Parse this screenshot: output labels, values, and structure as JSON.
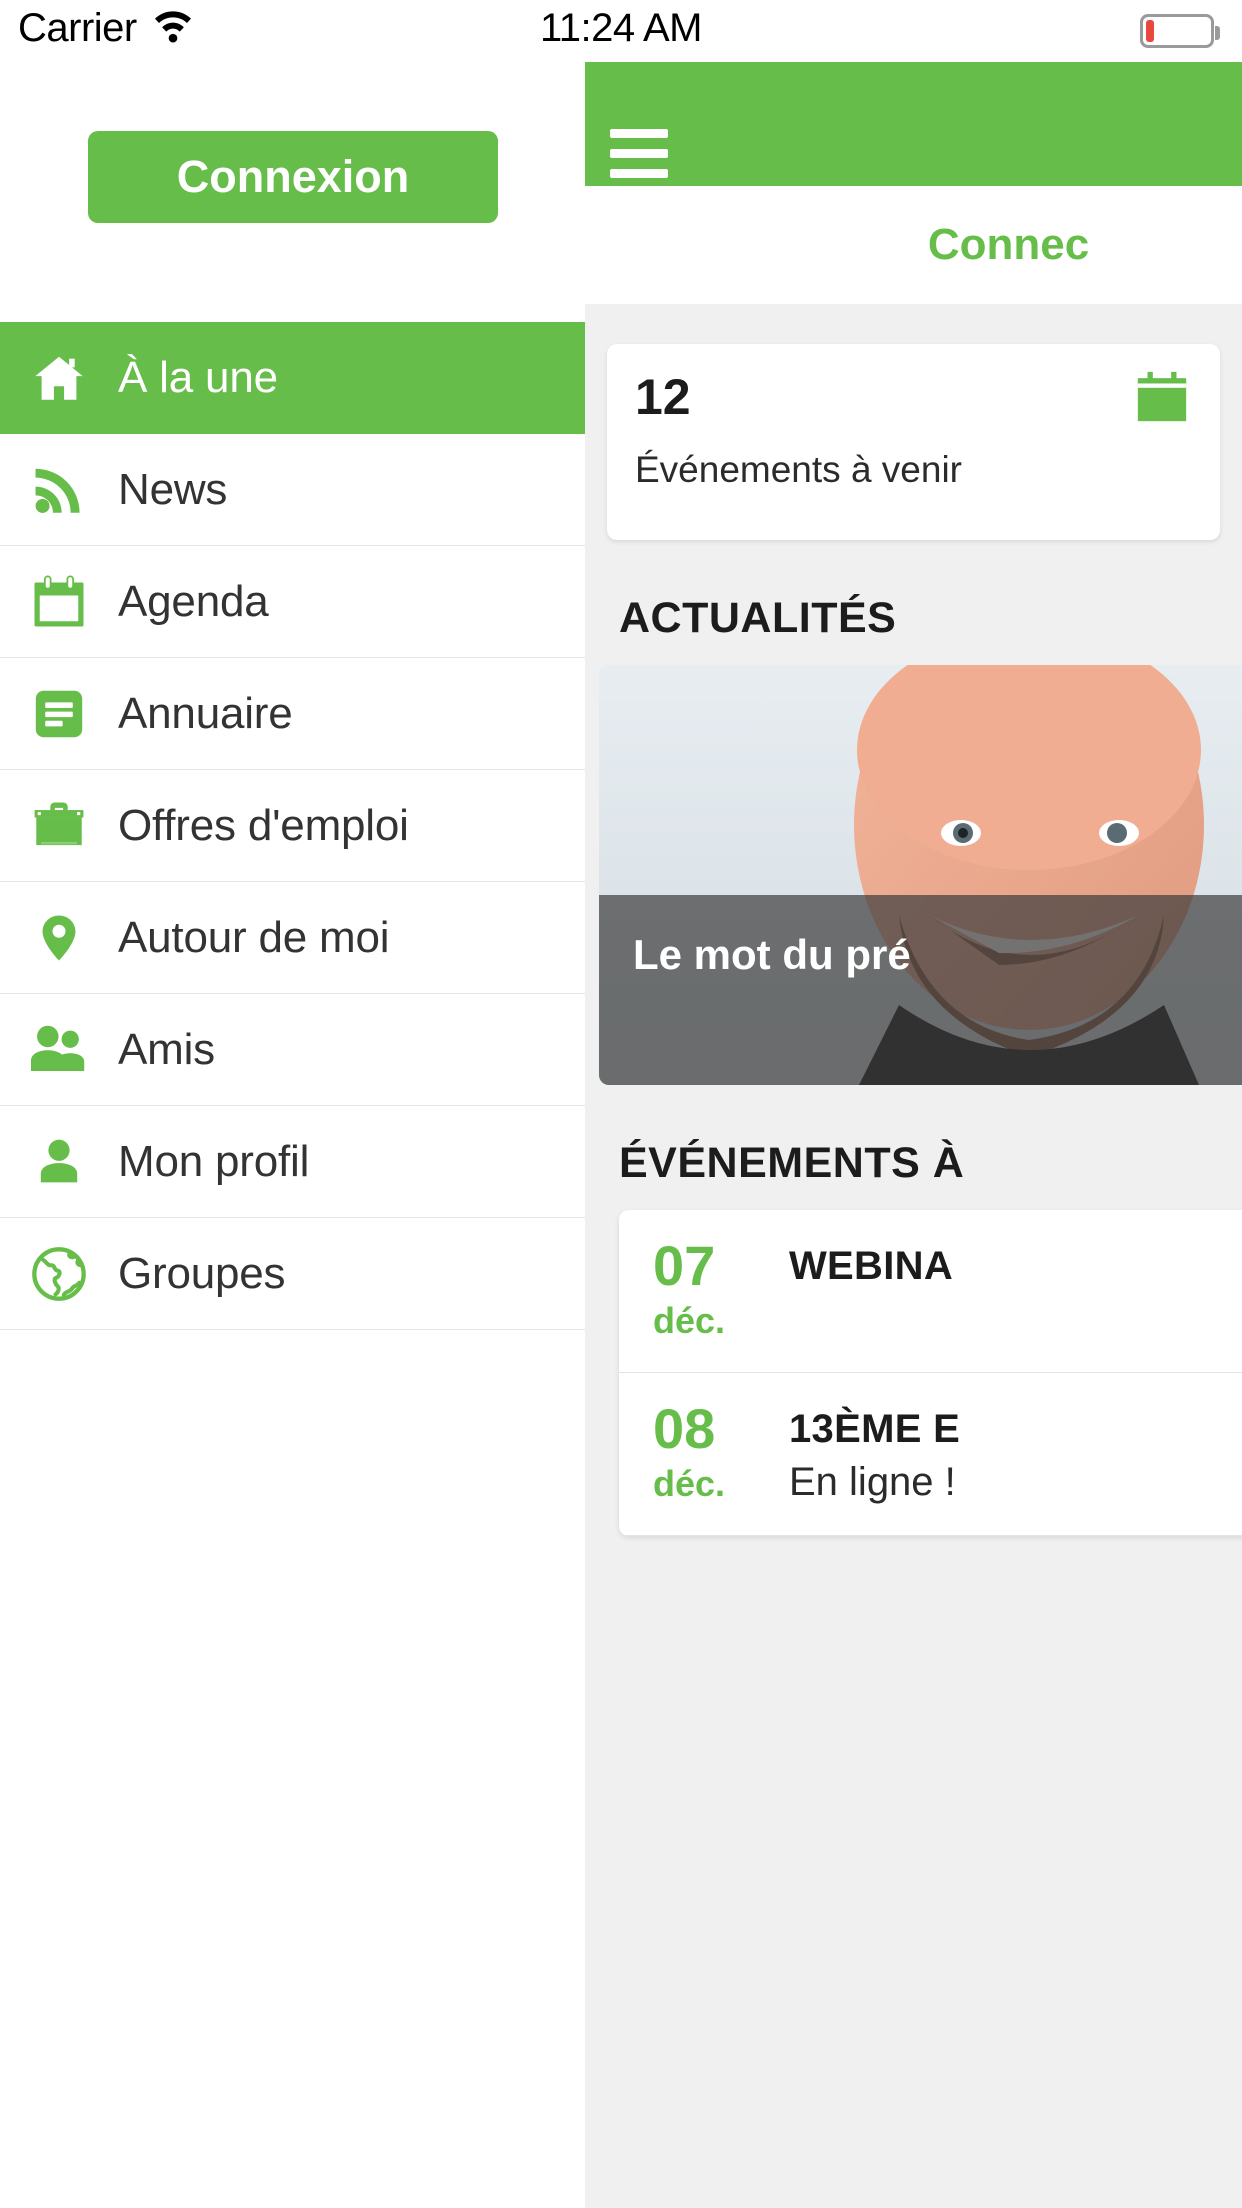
{
  "statusbar": {
    "carrier": "Carrier",
    "time": "11:24 AM",
    "wifi_icon": "wifi-icon",
    "battery_icon": "battery-low-icon"
  },
  "drawer": {
    "login_button_label": "Connexion",
    "menu_items": [
      {
        "label": "À la une",
        "icon": "home-icon",
        "active": true
      },
      {
        "label": "News",
        "icon": "rss-icon",
        "active": false
      },
      {
        "label": "Agenda",
        "icon": "calendar-icon",
        "active": false
      },
      {
        "label": "Annuaire",
        "icon": "directory-icon",
        "active": false
      },
      {
        "label": "Offres d'emploi",
        "icon": "briefcase-icon",
        "active": false
      },
      {
        "label": "Autour de moi",
        "icon": "map-pin-icon",
        "active": false
      },
      {
        "label": "Amis",
        "icon": "people-icon",
        "active": false
      },
      {
        "label": "Mon profil",
        "icon": "person-icon",
        "active": false
      },
      {
        "label": "Groupes",
        "icon": "globe-icon",
        "active": false
      }
    ]
  },
  "content": {
    "header": {
      "menu_icon": "hamburger-icon"
    },
    "login_link_label": "Connec",
    "stat_card": {
      "number": "12",
      "label": "Événements à venir",
      "icon": "calendar-icon"
    },
    "news_section_title": "ACTUALITÉS",
    "news_item": {
      "title": "Le mot du pré"
    },
    "events_section_title": "ÉVÉNEMENTS À",
    "events": [
      {
        "day": "07",
        "month": "déc.",
        "name": "WEBINA",
        "sub": ""
      },
      {
        "day": "08",
        "month": "déc.",
        "name": "13ÈME E",
        "sub": "En ligne !"
      }
    ]
  },
  "colors": {
    "brand_green": "#67bd4a",
    "text_dark": "#1c1c1c",
    "panel_bg": "#f0f0f0"
  }
}
